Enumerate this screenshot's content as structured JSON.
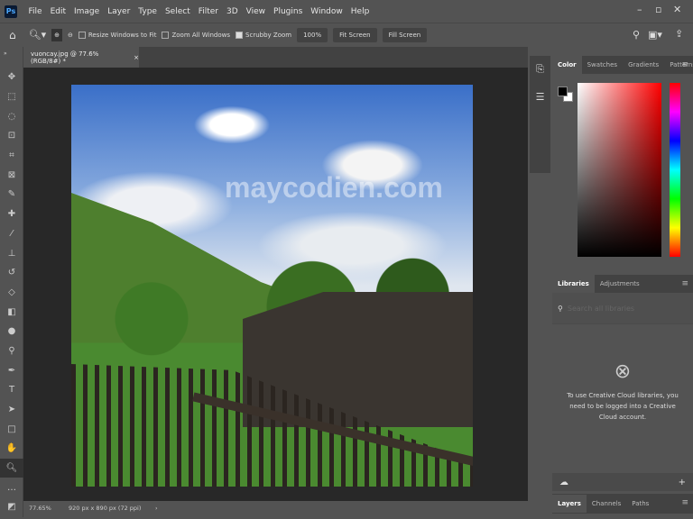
{
  "menubar": {
    "logo": "Ps",
    "items": [
      "File",
      "Edit",
      "Image",
      "Layer",
      "Type",
      "Select",
      "Filter",
      "3D",
      "View",
      "Plugins",
      "Window",
      "Help"
    ]
  },
  "options": {
    "resize_windows": "Resize Windows to Fit",
    "resize_checked": false,
    "zoom_all": "Zoom All Windows",
    "zoom_all_checked": false,
    "scrubby": "Scrubby Zoom",
    "scrubby_checked": true,
    "zoom_value": "100%",
    "fit_screen": "Fit Screen",
    "fill_screen": "Fill Screen"
  },
  "document": {
    "tab_title": "vuoncay.jpg @ 77.6% (RGB/8#) *",
    "watermark": "maycodien.com"
  },
  "status": {
    "zoom": "77.65%",
    "info": "920 px x 890 px (72 ppi)"
  },
  "color_panel": {
    "tabs": [
      "Color",
      "Swatches",
      "Gradients",
      "Patterns"
    ],
    "foreground": "#000000",
    "background": "#ffffff",
    "hue": "#ff0000"
  },
  "libraries_panel": {
    "tabs": [
      "Libraries",
      "Adjustments"
    ],
    "search_placeholder": "Search all libraries",
    "message": "To use Creative Cloud libraries, you need to be logged into a Creative Cloud account."
  },
  "layers_panel": {
    "tabs": [
      "Layers",
      "Channels",
      "Paths"
    ]
  }
}
